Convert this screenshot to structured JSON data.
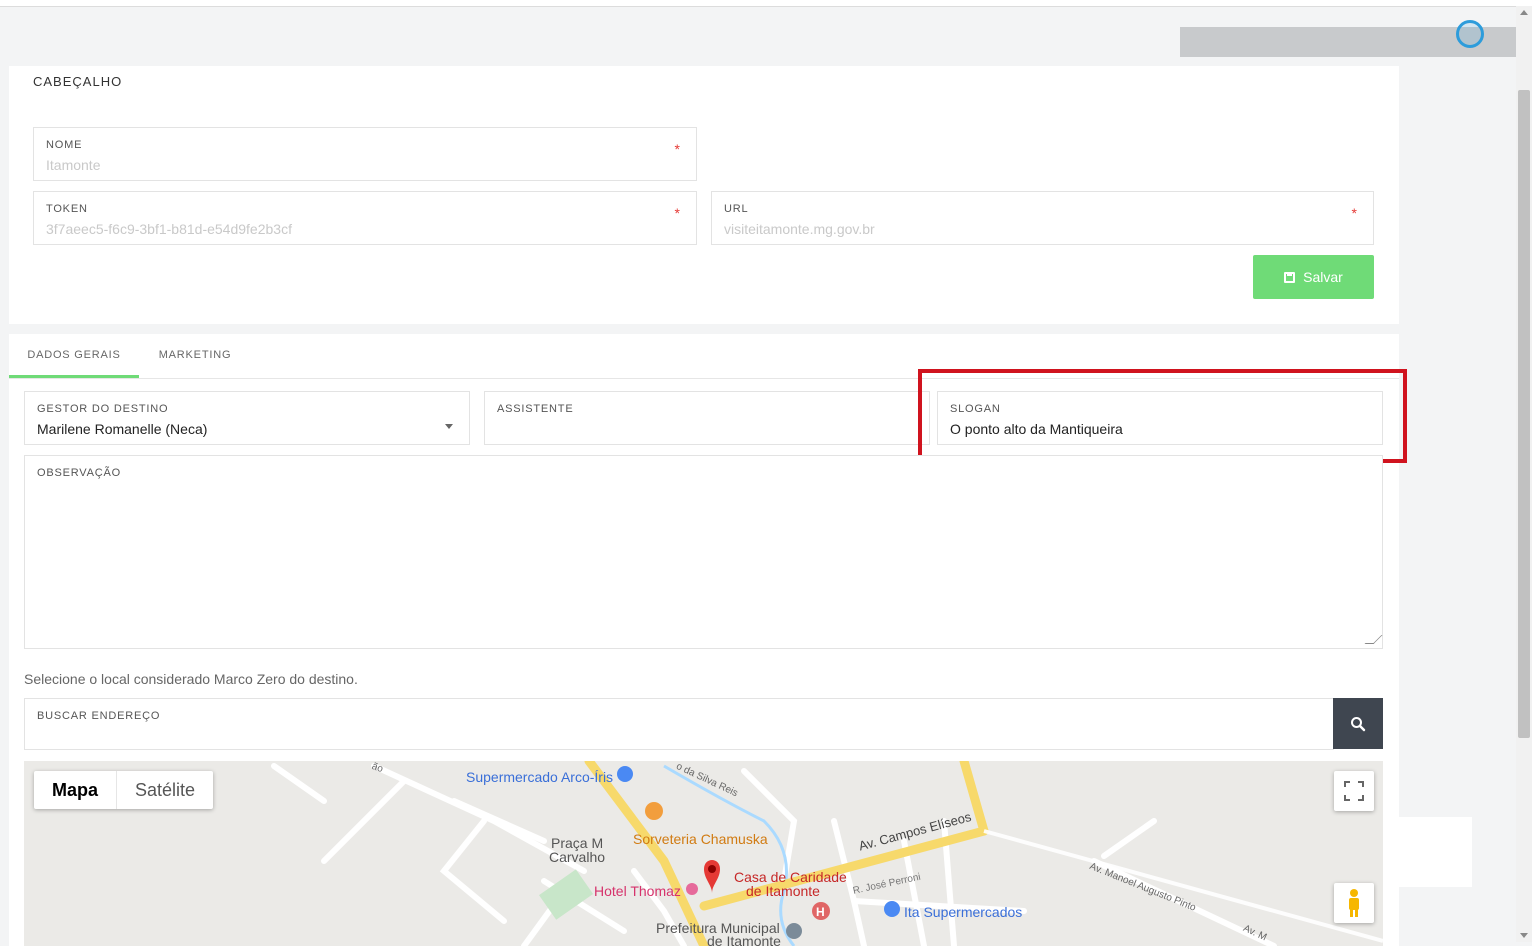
{
  "header": {
    "section_title": "CABEÇALHO",
    "nome": {
      "label": "NOME",
      "value": "Itamonte",
      "required": "*"
    },
    "token": {
      "label": "TOKEN",
      "value": "3f7aeec5-f6c9-3bf1-b81d-e54d9fe2b3cf",
      "required": "*"
    },
    "url": {
      "label": "URL",
      "value": "visiteitamonte.mg.gov.br",
      "required": "*"
    },
    "save_label": "Salvar"
  },
  "tabs": [
    {
      "label": "DADOS GERAIS",
      "active": true
    },
    {
      "label": "MARKETING",
      "active": false
    }
  ],
  "general": {
    "gestor": {
      "label": "GESTOR DO DESTINO",
      "value": "Marilene Romanelle (Neca)"
    },
    "assistente": {
      "label": "ASSISTENTE",
      "value": ""
    },
    "slogan": {
      "label": "SLOGAN",
      "value": "O ponto alto da Mantiqueira"
    },
    "observacao": {
      "label": "OBSERVAÇÃO",
      "value": ""
    }
  },
  "location": {
    "hint": "Selecione o local considerado Marco Zero do destino.",
    "search_label": "BUSCAR ENDEREÇO",
    "search_value": ""
  },
  "map": {
    "type_map": "Mapa",
    "type_satellite": "Satélite",
    "labels": {
      "supermercado_arco_iris": "Supermercado Arco-Íris",
      "sorveteria": "Sorveteria Chamuska",
      "praca_1": "Praça M",
      "praca_2": "Carvalho",
      "hotel": "Hotel Thomaz",
      "casa_caridade_1": "Casa de Caridade",
      "casa_caridade_2": "de Itamonte",
      "av_campos": "Av. Campos Elíseos",
      "r_jose": "R. José Perroni",
      "ita_super": "Ita Supermercados",
      "prefeitura_1": "Prefeitura Municipal",
      "prefeitura_2": "de Itamonte",
      "av_manoel": "Av. Manoel Augusto Pinto",
      "da_silva": "o da Silva Reis",
      "ao": "ão",
      "av_m": "Av. M"
    }
  },
  "colors": {
    "accent": "#6fdb77",
    "highlight": "#d0131e",
    "required": "#e53935",
    "search_button": "#3f4650"
  }
}
